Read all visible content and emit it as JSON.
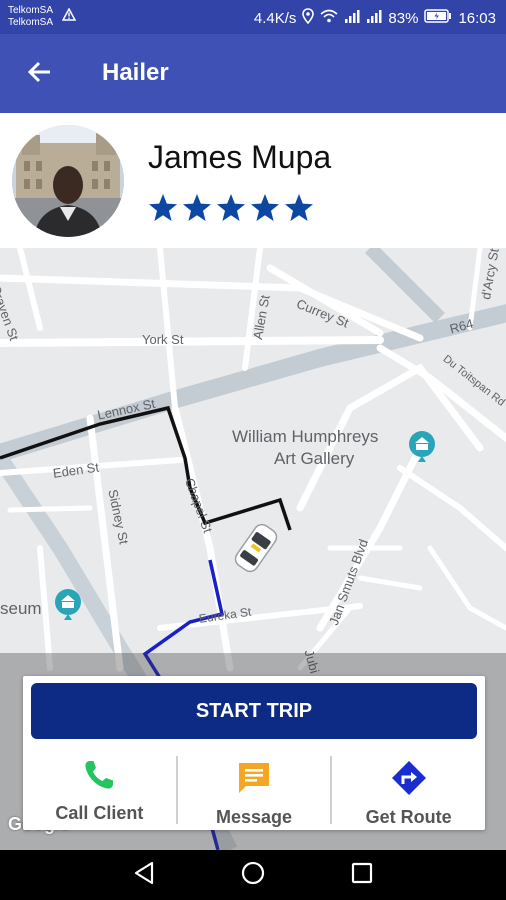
{
  "status_bar": {
    "carrier_1": "TelkomSA",
    "carrier_2": "TelkomSA",
    "network_speed": "4.4K/s",
    "battery": "83%",
    "time": "16:03"
  },
  "app_bar": {
    "title": "Hailer",
    "back_icon": "arrow-left-icon"
  },
  "driver": {
    "name": "James Mupa",
    "rating": 5,
    "rating_max": 5
  },
  "map": {
    "streets": {
      "craven": "Craven St",
      "york": "York St",
      "allen": "Allen St",
      "currey": "Currey St",
      "r64": "R64",
      "darcy": "d'Arcy St",
      "du_toitspan": "Du Toitspan Rd",
      "lennox": "Lennox St",
      "eden": "Eden St",
      "sidney": "Sidney St",
      "chapel": "Chapel St",
      "eureka": "Eureka St",
      "jan_smuts": "Jan Smuts Blvd",
      "jubilee": "Jubi"
    },
    "poi": {
      "gallery_line1": "William Humphreys",
      "gallery_line2": "Art Gallery",
      "museum": "seum"
    },
    "attribution": "Google",
    "colors": {
      "route_done": "#111111",
      "route_next": "#1a20c8",
      "poi": "#2aa5b8"
    }
  },
  "actions": {
    "start_trip": "START TRIP",
    "call_client": "Call Client",
    "message": "Message",
    "get_route": "Get Route",
    "colors": {
      "call": "#22c55e",
      "message": "#f5a623",
      "route": "#1a2ecf",
      "start_button": "#0d2a84"
    }
  }
}
